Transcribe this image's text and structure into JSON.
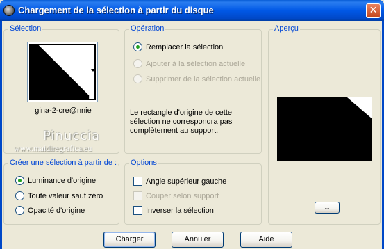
{
  "window": {
    "title": "Chargement de la sélection à partir du disque",
    "close_glyph": "✕"
  },
  "selection_group": {
    "label": "Sélection",
    "file_name": "gina-2-cre@nnie"
  },
  "watermark": {
    "name": "Pinuccia",
    "url": "www.maidiregrafica.eu"
  },
  "operation_group": {
    "label": "Opération",
    "options": [
      {
        "label": "Remplacer la sélection",
        "checked": true,
        "enabled": true
      },
      {
        "label": "Ajouter à la sélection actuelle",
        "checked": false,
        "enabled": false
      },
      {
        "label": "Supprimer de la sélection actuelle",
        "checked": false,
        "enabled": false
      }
    ],
    "note": "Le rectangle d'origine de cette sélection ne correspondra pas complètement au support."
  },
  "preview_group": {
    "label": "Aperçu",
    "small_button_label": "..."
  },
  "create_group": {
    "label": "Créer une sélection à partir de :",
    "options": [
      {
        "label": "Luminance d'origine",
        "checked": true
      },
      {
        "label": "Toute valeur sauf zéro",
        "checked": false
      },
      {
        "label": "Opacité d'origine",
        "checked": false
      }
    ]
  },
  "options_group": {
    "label": "Options",
    "checks": [
      {
        "label": "Angle supérieur gauche",
        "checked": false,
        "enabled": true
      },
      {
        "label": "Couper selon support",
        "checked": false,
        "enabled": false
      },
      {
        "label": "Inverser la sélection",
        "checked": false,
        "enabled": true
      }
    ]
  },
  "buttons": {
    "load": "Charger",
    "cancel": "Annuler",
    "help": "Aide"
  }
}
